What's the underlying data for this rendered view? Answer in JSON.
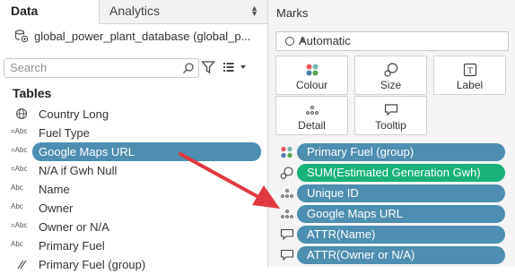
{
  "tabs": {
    "data": "Data",
    "analytics": "Analytics"
  },
  "datasource": {
    "name": "global_power_plant_database (global_p..."
  },
  "search": {
    "placeholder": "Search"
  },
  "tables_header": "Tables",
  "fields": [
    {
      "type": "globe",
      "type_label": "",
      "name": "Country Long"
    },
    {
      "type": "abc",
      "type_label": "=Abc",
      "name": "Fuel Type"
    },
    {
      "type": "abc",
      "type_label": "=Abc",
      "name": "Google Maps URL",
      "selected": true
    },
    {
      "type": "abc",
      "type_label": "=Abc",
      "name": "N/A if Gwh Null"
    },
    {
      "type": "abc",
      "type_label": "Abc",
      "name": "Name"
    },
    {
      "type": "abc",
      "type_label": "Abc",
      "name": "Owner"
    },
    {
      "type": "abc",
      "type_label": "=Abc",
      "name": "Owner or N/A"
    },
    {
      "type": "abc",
      "type_label": "Abc",
      "name": "Primary Fuel"
    },
    {
      "type": "group",
      "type_label": "",
      "name": "Primary Fuel (group)"
    }
  ],
  "marks": {
    "title": "Marks",
    "mark_type": "Automatic",
    "buttons": {
      "colour": "Colour",
      "size": "Size",
      "label": "Label",
      "detail": "Detail",
      "tooltip": "Tooltip"
    },
    "shelf": [
      {
        "icon": "colour-icon",
        "label": "Primary Fuel (group)",
        "color": "#4c8fb0"
      },
      {
        "icon": "size-icon",
        "label": "SUM(Estimated Generation Gwh)",
        "color": "#16b27a"
      },
      {
        "icon": "detail-icon",
        "label": "Unique ID",
        "color": "#4c8fb0"
      },
      {
        "icon": "detail-icon",
        "label": "Google Maps URL",
        "color": "#4c8fb0"
      },
      {
        "icon": "tooltip-icon",
        "label": "ATTR(Name)",
        "color": "#4c8fb0"
      },
      {
        "icon": "tooltip-icon",
        "label": "ATTR(Owner or N/A)",
        "color": "#4c8fb0"
      }
    ]
  },
  "colors": {
    "dimension_pill": "#4c8fb0",
    "measure_pill": "#16b27a",
    "arrow": "#e0393e"
  }
}
